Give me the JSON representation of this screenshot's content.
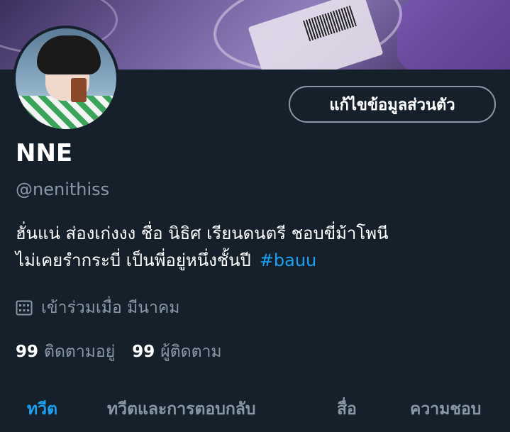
{
  "profile": {
    "edit_button": "แก้ไขข้อมูลส่วนตัว",
    "name": "NNE",
    "handle": "@nenithiss",
    "bio_line1": "ฮั่นแน่ ส่องเก่งงง ชื่อ นิธิศ เรียนดนตรี ชอบขี่ม้าโพนี",
    "bio_line2": "ไม่เคยรำกระบี่ เป็นพี่อยู่หนึ่งชั้นปี",
    "bio_hashtag": "#bauu",
    "joined": "เข้าร่วมเมื่อ มีนาคม",
    "following_count": "99",
    "following_label": "ติดตามอยู่",
    "followers_count": "99",
    "followers_label": "ผู้ติดตาม"
  },
  "tabs": [
    {
      "label": "ทวีต",
      "active": true
    },
    {
      "label": "ทวีตและการตอบกลับ",
      "active": false
    },
    {
      "label": "สื่อ",
      "active": false
    },
    {
      "label": "ความชอบ",
      "active": false
    }
  ],
  "icons": {
    "joined": "calendar-icon"
  },
  "colors": {
    "background": "#15202b",
    "accent": "#1da1f2",
    "secondary_text": "#8899a6"
  }
}
